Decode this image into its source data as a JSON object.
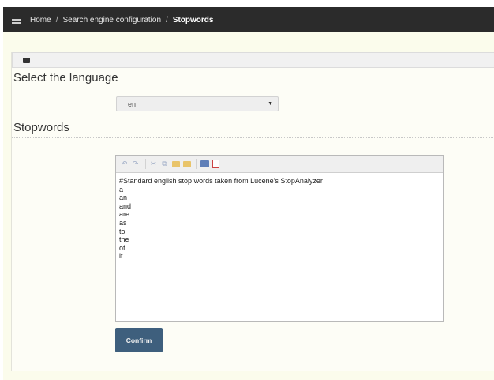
{
  "breadcrumb": {
    "items": [
      "Home",
      "Search engine configuration",
      "Stopwords"
    ],
    "separator": "/"
  },
  "language_section": {
    "title": "Select the language",
    "selected_value": "en"
  },
  "stopwords_section": {
    "title": "Stopwords",
    "toolbar_icons": [
      "undo-icon",
      "redo-icon",
      "cut-icon",
      "copy-icon",
      "paste-icon",
      "paste-text-icon",
      "print-icon",
      "pdf-icon"
    ],
    "content_lines": [
      "#Standard english stop words taken from Lucene's StopAnalyzer",
      "a",
      "an",
      "and",
      "are",
      "as",
      "to",
      "the",
      "of",
      "it"
    ]
  },
  "actions": {
    "confirm_label": "Confirm"
  },
  "colors": {
    "topbar": "#2b2b2b",
    "page_background": "#fbfcec",
    "confirm_button": "#3e5f7d"
  }
}
